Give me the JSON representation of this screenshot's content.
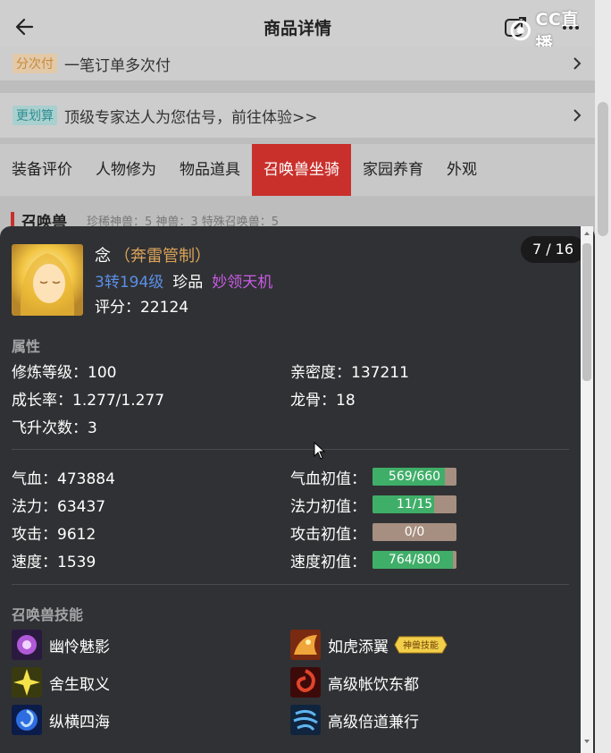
{
  "header": {
    "title": "商品详情",
    "watermark": "CC直播"
  },
  "promo_rows": [
    {
      "tag": "分次付",
      "text": "一笔订单多次付"
    },
    {
      "tag": "更划算",
      "text": "顶级专家达人为您估号，前往体验>>"
    }
  ],
  "tabs": [
    "装备评价",
    "人物修为",
    "物品道具",
    "召唤兽坐骑",
    "家园养育",
    "外观"
  ],
  "active_tab": "召唤兽坐骑",
  "section": {
    "title": "召唤兽",
    "stats": "珍稀神兽：5  神兽：3  特殊召唤兽：5"
  },
  "pet_card": {
    "pager": "7 / 16",
    "name": "念",
    "kind": "（奔雷管制）",
    "level": "3转194级",
    "rank": "珍品",
    "special_skill": "妙领天机",
    "score": "评分：22124",
    "attr_title": "属性",
    "attributes": {
      "cultivation": "修炼等级：100",
      "intimacy": "亲密度：137211",
      "growth": "成长率：1.277/1.277",
      "dragon_bone": "龙骨：18",
      "ascension": "飞升次数：3"
    },
    "stats": {
      "hp": "气血：473884",
      "mp": "法力：63437",
      "atk": "攻击：9612",
      "spd": "速度：1539"
    },
    "aptitudes": [
      {
        "label": "气血初值：",
        "value": "569/660",
        "fill": 0.862
      },
      {
        "label": "法力初值：",
        "value": "11/15",
        "fill": 0.733
      },
      {
        "label": "攻击初值：",
        "value": "0/0",
        "fill": 0
      },
      {
        "label": "速度初值：",
        "value": "764/800",
        "fill": 0.955
      }
    ],
    "skill_title": "召唤兽技能",
    "skills": [
      {
        "name": "幽怜魅影",
        "icon": "purple-flower-icon"
      },
      {
        "name": "如虎添翼",
        "icon": "tiger-icon",
        "badge": "神兽技能"
      },
      {
        "name": "舍生取义",
        "icon": "golden-light-icon"
      },
      {
        "name": "高级帐饮东都",
        "icon": "red-vortex-icon"
      },
      {
        "name": "纵横四海",
        "icon": "blue-swirl-icon"
      },
      {
        "name": "高级倍道兼行",
        "icon": "blue-wind-icon"
      }
    ]
  },
  "colors": {
    "card_bg": "#303134",
    "accent_red": "#c9302c",
    "bar_green": "#3fae68",
    "bar_track": "#a68f80",
    "level_blue": "#5b8fe6",
    "skill_purple": "#c95be6",
    "kind_gold": "#d9a35a"
  }
}
